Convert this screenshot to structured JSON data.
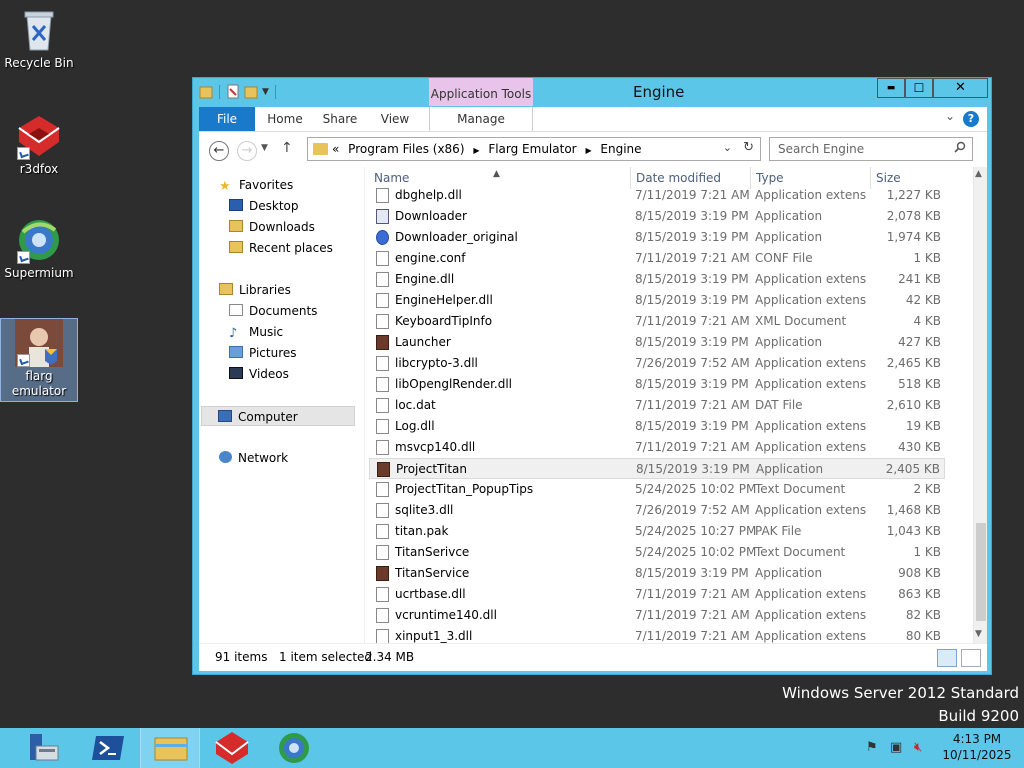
{
  "desktop": {
    "icons": [
      {
        "label": "Recycle Bin",
        "icon": "recycle-bin-icon"
      },
      {
        "label": "r3dfox",
        "icon": "r3dfox-icon"
      },
      {
        "label": "Supermium",
        "icon": "supermium-icon"
      },
      {
        "label": "flarg emulator",
        "icon": "flarg-emulator-icon"
      }
    ],
    "watermark": {
      "line1": "Windows Server 2012 Standard",
      "line2": "Build 9200"
    }
  },
  "window": {
    "title": "Engine",
    "context_tab_group": "Application Tools",
    "tabs": {
      "file": "File",
      "home": "Home",
      "share": "Share",
      "view": "View",
      "manage": "Manage"
    },
    "controls": {
      "minimize": "▬",
      "maximize": "☐",
      "close": "✕"
    },
    "help": "?"
  },
  "navigation": {
    "breadcrumb_prefix": "«",
    "breadcrumb": [
      "Program Files (x86)",
      "Flarg Emulator",
      "Engine"
    ],
    "search_placeholder": "Search Engine"
  },
  "nav_pane": {
    "favorites": "Favorites",
    "desktop": "Desktop",
    "downloads": "Downloads",
    "recent": "Recent places",
    "libraries": "Libraries",
    "documents": "Documents",
    "music": "Music",
    "pictures": "Pictures",
    "videos": "Videos",
    "computer": "Computer",
    "network": "Network"
  },
  "columns": {
    "name": "Name",
    "date": "Date modified",
    "type": "Type",
    "size": "Size"
  },
  "files": [
    {
      "name": "dbghelp.dll",
      "date": "7/11/2019 7:21 AM",
      "type": "Application extens...",
      "size": "1,227 KB",
      "icon": "dll"
    },
    {
      "name": "Downloader",
      "date": "8/15/2019 3:19 PM",
      "type": "Application",
      "size": "2,078 KB",
      "icon": "app"
    },
    {
      "name": "Downloader_original",
      "date": "8/15/2019 3:19 PM",
      "type": "Application",
      "size": "1,974 KB",
      "icon": "blue"
    },
    {
      "name": "engine.conf",
      "date": "7/11/2019 7:21 AM",
      "type": "CONF File",
      "size": "1 KB",
      "icon": "file"
    },
    {
      "name": "Engine.dll",
      "date": "8/15/2019 3:19 PM",
      "type": "Application extens...",
      "size": "241 KB",
      "icon": "dll"
    },
    {
      "name": "EngineHelper.dll",
      "date": "8/15/2019 3:19 PM",
      "type": "Application extens...",
      "size": "42 KB",
      "icon": "dll"
    },
    {
      "name": "KeyboardTipInfo",
      "date": "7/11/2019 7:21 AM",
      "type": "XML Document",
      "size": "4 KB",
      "icon": "xml"
    },
    {
      "name": "Launcher",
      "date": "8/15/2019 3:19 PM",
      "type": "Application",
      "size": "427 KB",
      "icon": "img"
    },
    {
      "name": "libcrypto-3.dll",
      "date": "7/26/2019 7:52 AM",
      "type": "Application extens...",
      "size": "2,465 KB",
      "icon": "dll"
    },
    {
      "name": "libOpenglRender.dll",
      "date": "8/15/2019 3:19 PM",
      "type": "Application extens...",
      "size": "518 KB",
      "icon": "dll"
    },
    {
      "name": "loc.dat",
      "date": "7/11/2019 7:21 AM",
      "type": "DAT File",
      "size": "2,610 KB",
      "icon": "file"
    },
    {
      "name": "Log.dll",
      "date": "8/15/2019 3:19 PM",
      "type": "Application extens...",
      "size": "19 KB",
      "icon": "dll"
    },
    {
      "name": "msvcp140.dll",
      "date": "7/11/2019 7:21 AM",
      "type": "Application extens...",
      "size": "430 KB",
      "icon": "dll"
    },
    {
      "name": "ProjectTitan",
      "date": "8/15/2019 3:19 PM",
      "type": "Application",
      "size": "2,405 KB",
      "icon": "img",
      "selected": true
    },
    {
      "name": "ProjectTitan_PopupTips",
      "date": "5/24/2025 10:02 PM",
      "type": "Text Document",
      "size": "2 KB",
      "icon": "file"
    },
    {
      "name": "sqlite3.dll",
      "date": "7/26/2019 7:52 AM",
      "type": "Application extens...",
      "size": "1,468 KB",
      "icon": "dll"
    },
    {
      "name": "titan.pak",
      "date": "5/24/2025 10:27 PM",
      "type": "PAK File",
      "size": "1,043 KB",
      "icon": "file"
    },
    {
      "name": "TitanSerivce",
      "date": "5/24/2025 10:02 PM",
      "type": "Text Document",
      "size": "1 KB",
      "icon": "file"
    },
    {
      "name": "TitanService",
      "date": "8/15/2019 3:19 PM",
      "type": "Application",
      "size": "908 KB",
      "icon": "img"
    },
    {
      "name": "ucrtbase.dll",
      "date": "7/11/2019 7:21 AM",
      "type": "Application extens...",
      "size": "863 KB",
      "icon": "dll"
    },
    {
      "name": "vcruntime140.dll",
      "date": "7/11/2019 7:21 AM",
      "type": "Application extens...",
      "size": "82 KB",
      "icon": "dll"
    },
    {
      "name": "xinput1_3.dll",
      "date": "7/11/2019 7:21 AM",
      "type": "Application extens...",
      "size": "80 KB",
      "icon": "dll"
    }
  ],
  "status": {
    "count": "91 items",
    "selection": "1 item selected",
    "size": "2.34 MB"
  },
  "taskbar": {
    "buttons": [
      "server-manager-icon",
      "powershell-icon",
      "file-explorer-icon",
      "r3dfox-icon",
      "supermium-icon"
    ],
    "time": "4:13 PM",
    "date": "10/11/2025"
  },
  "colors": {
    "accent": "#1979ca",
    "taskbar": "#5cc6e8",
    "context_tab": "#e8c4ea"
  }
}
